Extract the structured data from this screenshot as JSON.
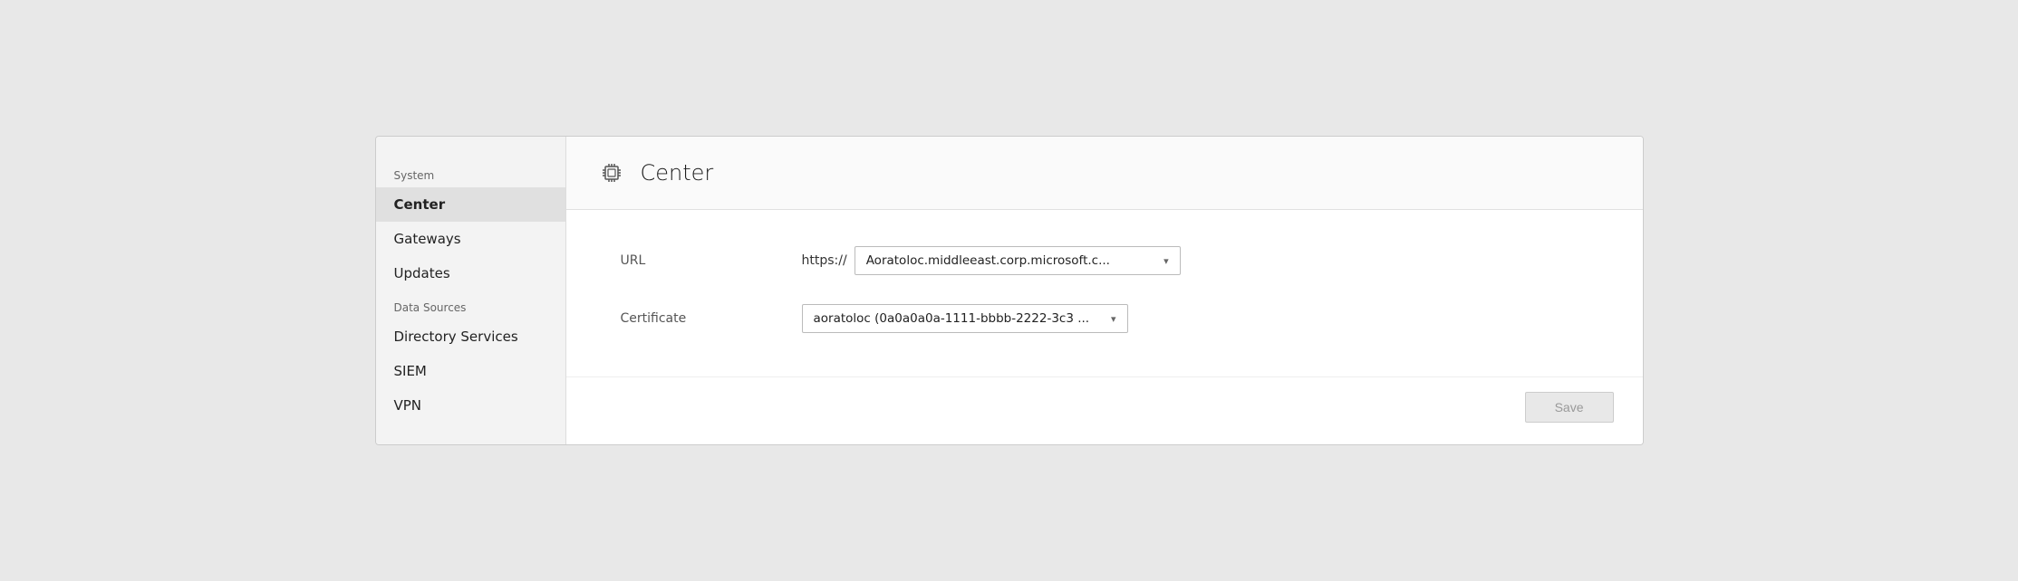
{
  "sidebar": {
    "system_label": "System",
    "items": [
      {
        "id": "center",
        "label": "Center",
        "active": true
      },
      {
        "id": "gateways",
        "label": "Gateways",
        "active": false
      },
      {
        "id": "updates",
        "label": "Updates",
        "active": false
      }
    ],
    "data_sources_label": "Data Sources",
    "data_sources_items": [
      {
        "id": "directory-services",
        "label": "Directory Services",
        "active": false
      },
      {
        "id": "siem",
        "label": "SIEM",
        "active": false
      },
      {
        "id": "vpn",
        "label": "VPN",
        "active": false
      }
    ]
  },
  "page": {
    "title": "Center",
    "icon_label": "chip-icon"
  },
  "form": {
    "url_label": "URL",
    "url_prefix": "https://",
    "url_value": "Aoratoloc.middleeast.corp.microsoft.c...",
    "certificate_label": "Certificate",
    "certificate_value": "aoratoloc (0a0a0a0a-1111-bbbb-2222-3c3 ..."
  },
  "footer": {
    "save_label": "Save"
  }
}
